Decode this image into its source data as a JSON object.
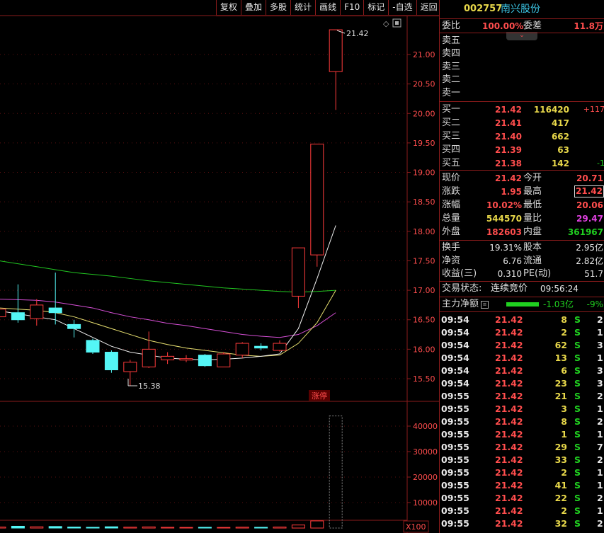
{
  "toolbar": {
    "buttons": [
      "复权",
      "叠加",
      "多股",
      "统计",
      "画线",
      "F10",
      "标记",
      "-自选",
      "返回"
    ]
  },
  "stock": {
    "code": "002757",
    "name": "南兴股份"
  },
  "price_axis": [
    "21.00",
    "20.50",
    "20.00",
    "19.50",
    "19.00",
    "18.50",
    "18.00",
    "17.50",
    "17.00",
    "16.50",
    "16.00",
    "15.50"
  ],
  "volume_axis": [
    "40000",
    "30000",
    "20000",
    "10000"
  ],
  "volume_unit": "X100",
  "annotations": {
    "high": "21.42",
    "low": "15.38",
    "limit_tag": "涨停"
  },
  "order_book": {
    "weibi_label": "委比",
    "weibi_value": "100.00%",
    "weicha_label": "委差",
    "weicha_value": "11.8万",
    "asks": [
      {
        "label": "卖五"
      },
      {
        "label": "卖四"
      },
      {
        "label": "卖三"
      },
      {
        "label": "卖二"
      },
      {
        "label": "卖一"
      }
    ],
    "bids": [
      {
        "label": "买一",
        "price": "21.42",
        "vol": "116420",
        "chg": "+117"
      },
      {
        "label": "买二",
        "price": "21.41",
        "vol": "417",
        "chg": ""
      },
      {
        "label": "买三",
        "price": "21.40",
        "vol": "662",
        "chg": ""
      },
      {
        "label": "买四",
        "price": "21.39",
        "vol": "63",
        "chg": ""
      },
      {
        "label": "买五",
        "price": "21.38",
        "vol": "142",
        "chg": "-1"
      }
    ]
  },
  "quote": {
    "xianjia_label": "现价",
    "xianjia": "21.42",
    "jinkai_label": "今开",
    "jinkai": "20.71",
    "zhangdie_label": "涨跌",
    "zhangdie": "1.95",
    "zuigao_label": "最高",
    "zuigao": "21.42",
    "zhangfu_label": "涨幅",
    "zhangfu": "10.02%",
    "zuidi_label": "最低",
    "zuidi": "20.06",
    "zongliang_label": "总量",
    "zongliang": "544570",
    "liangbi_label": "量比",
    "liangbi": "29.47",
    "waipan_label": "外盘",
    "waipan": "182603",
    "neipan_label": "内盘",
    "neipan": "361967",
    "huanshou_label": "换手",
    "huanshou": "19.31%",
    "guben_label": "股本",
    "guben": "2.95亿",
    "jingzi_label": "净资",
    "jingzi": "6.76",
    "liutong_label": "流通",
    "liutong": "2.82亿",
    "shouyi_label": "收益(三)",
    "shouyi": "0.310",
    "pe_label": "PE(动)",
    "pe": "51.7",
    "status_label": "交易状态:",
    "status": "连续竞价",
    "time": "09:56:24",
    "flow_label": "主力净额",
    "flow_value": "-1.03亿",
    "flow_pct": "-9%"
  },
  "ticks": [
    {
      "t": "09:54",
      "p": "21.42",
      "v": "8",
      "s": "S",
      "n": "2"
    },
    {
      "t": "09:54",
      "p": "21.42",
      "v": "2",
      "s": "S",
      "n": "1"
    },
    {
      "t": "09:54",
      "p": "21.42",
      "v": "62",
      "s": "S",
      "n": "3"
    },
    {
      "t": "09:54",
      "p": "21.42",
      "v": "13",
      "s": "S",
      "n": "1"
    },
    {
      "t": "09:54",
      "p": "21.42",
      "v": "6",
      "s": "S",
      "n": "3"
    },
    {
      "t": "09:54",
      "p": "21.42",
      "v": "23",
      "s": "S",
      "n": "3"
    },
    {
      "t": "09:55",
      "p": "21.42",
      "v": "21",
      "s": "S",
      "n": "2"
    },
    {
      "t": "09:55",
      "p": "21.42",
      "v": "3",
      "s": "S",
      "n": "1"
    },
    {
      "t": "09:55",
      "p": "21.42",
      "v": "8",
      "s": "S",
      "n": "2"
    },
    {
      "t": "09:55",
      "p": "21.42",
      "v": "1",
      "s": "S",
      "n": "1"
    },
    {
      "t": "09:55",
      "p": "21.42",
      "v": "29",
      "s": "S",
      "n": "7"
    },
    {
      "t": "09:55",
      "p": "21.42",
      "v": "33",
      "s": "S",
      "n": "2"
    },
    {
      "t": "09:55",
      "p": "21.42",
      "v": "2",
      "s": "S",
      "n": "1"
    },
    {
      "t": "09:55",
      "p": "21.42",
      "v": "41",
      "s": "S",
      "n": "1"
    },
    {
      "t": "09:55",
      "p": "21.42",
      "v": "22",
      "s": "S",
      "n": "2"
    },
    {
      "t": "09:55",
      "p": "21.42",
      "v": "2",
      "s": "S",
      "n": "1"
    },
    {
      "t": "09:55",
      "p": "21.42",
      "v": "32",
      "s": "S",
      "n": "2"
    }
  ],
  "chart_data": {
    "type": "candlestick",
    "ylim": [
      15.2,
      21.6
    ],
    "candles": [
      {
        "o": 16.55,
        "c": 16.68,
        "h": 16.9,
        "l": 16.5
      },
      {
        "o": 16.62,
        "c": 16.5,
        "h": 17.1,
        "l": 16.45
      },
      {
        "o": 16.52,
        "c": 16.75,
        "h": 16.85,
        "l": 16.4
      },
      {
        "o": 16.7,
        "c": 16.62,
        "h": 17.3,
        "l": 16.42
      },
      {
        "o": 16.42,
        "c": 16.35,
        "h": 16.5,
        "l": 16.2
      },
      {
        "o": 16.15,
        "c": 15.95,
        "h": 16.18,
        "l": 15.92
      },
      {
        "o": 15.95,
        "c": 15.65,
        "h": 15.98,
        "l": 15.6
      },
      {
        "o": 15.62,
        "c": 15.78,
        "h": 15.82,
        "l": 15.38
      },
      {
        "o": 15.7,
        "c": 16.0,
        "h": 16.3,
        "l": 15.68
      },
      {
        "o": 15.82,
        "c": 15.88,
        "h": 15.95,
        "l": 15.75
      },
      {
        "o": 15.82,
        "c": 15.84,
        "h": 15.9,
        "l": 15.78
      },
      {
        "o": 15.9,
        "c": 15.72,
        "h": 15.92,
        "l": 15.7
      },
      {
        "o": 15.7,
        "c": 15.92,
        "h": 15.95,
        "l": 15.7
      },
      {
        "o": 15.9,
        "c": 16.1,
        "h": 16.12,
        "l": 15.85
      },
      {
        "o": 16.05,
        "c": 16.02,
        "h": 16.1,
        "l": 15.98
      },
      {
        "o": 15.98,
        "c": 16.1,
        "h": 16.15,
        "l": 15.96
      },
      {
        "o": 16.9,
        "c": 17.72,
        "h": 17.72,
        "l": 16.7
      },
      {
        "o": 17.6,
        "c": 19.48,
        "h": 19.48,
        "l": 17.4
      },
      {
        "o": 20.71,
        "c": 21.42,
        "h": 21.42,
        "l": 20.06
      }
    ],
    "ma5": [
      16.65,
      16.6,
      16.55,
      16.5,
      16.35,
      16.2,
      16.05,
      15.95,
      15.9,
      15.85,
      15.83,
      15.82,
      15.83,
      15.85,
      15.88,
      15.92,
      16.35,
      17.2,
      18.1
    ],
    "ma10": [
      16.7,
      16.68,
      16.66,
      16.62,
      16.55,
      16.45,
      16.35,
      16.25,
      16.15,
      16.08,
      16.02,
      15.98,
      15.94,
      15.9,
      15.88,
      15.9,
      16.1,
      16.45,
      17.0
    ],
    "ma20": [
      16.85,
      16.84,
      16.83,
      16.8,
      16.75,
      16.7,
      16.62,
      16.55,
      16.5,
      16.44,
      16.4,
      16.35,
      16.3,
      16.25,
      16.22,
      16.2,
      16.25,
      16.4,
      16.62
    ],
    "ma60": [
      17.5,
      17.45,
      17.4,
      17.35,
      17.3,
      17.27,
      17.24,
      17.2,
      17.16,
      17.13,
      17.1,
      17.07,
      17.04,
      17.02,
      17.0,
      16.98,
      16.97,
      16.98,
      17.0
    ],
    "volume_ylim": [
      0,
      46000
    ],
    "volume": [
      400,
      700,
      500,
      600,
      400,
      300,
      500,
      350,
      450,
      300,
      250,
      300,
      250,
      350,
      300,
      400,
      1200,
      2800,
      5445
    ]
  }
}
